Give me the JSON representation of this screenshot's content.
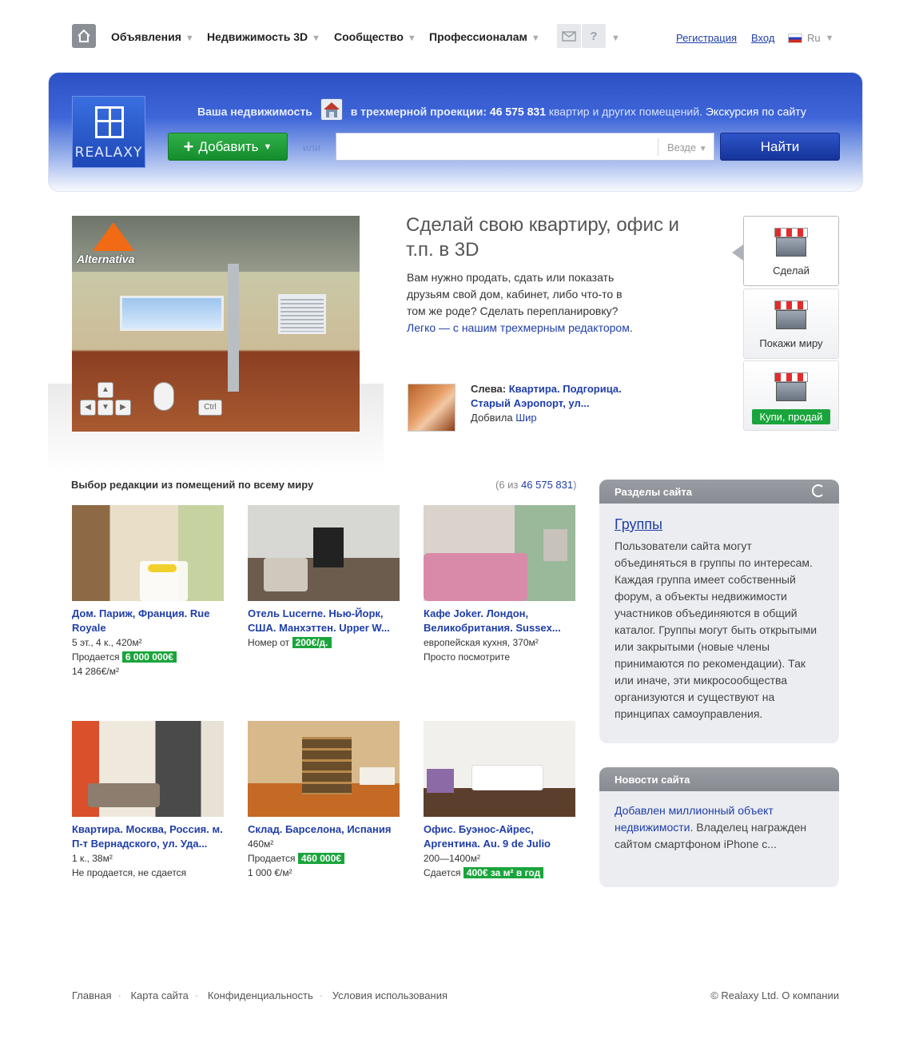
{
  "nav": {
    "items": [
      {
        "label": "Объявления"
      },
      {
        "label": "Недвижимость 3D"
      },
      {
        "label": "Сообщество"
      },
      {
        "label": "Профессионалам"
      }
    ],
    "help_label": "?",
    "register": "Регистрация",
    "login": "Вход",
    "lang": "Ru"
  },
  "banner": {
    "logo_text": "REALAXY",
    "tag_prefix": "Ваша недвижимость",
    "tag_middle": "в трехмерной проекции:",
    "count": "46 575 831",
    "tag_suffix": "квартир и других помещений.",
    "tour_link": "Экскурсия по сайту",
    "add_button": "Добавить",
    "or": "или",
    "search_placeholder": "",
    "where": "Везде",
    "find_button": "Найти"
  },
  "promo": {
    "brand": "Alternativa",
    "title": "Сделай свою квартиру, офис и т.п. в 3D",
    "text": "Вам нужно продать, сдать или показать друзьям свой дом, кабинет, либо что-то в том же роде? Сделать  перепланировку?",
    "link": "Легко — с нашим трехмерным редактором",
    "link_tail": ".",
    "credit_label": "Слева:",
    "credit_title": "Квартира. Подгорица. Старый Аэропорт, ул...",
    "added_by_label": "Добвила",
    "added_by": "Шир",
    "steps": [
      {
        "label": "Сделай"
      },
      {
        "label": "Покажи миру"
      },
      {
        "label": "Купи, продай"
      }
    ]
  },
  "editors": {
    "title": "Выбор редакции из помещений по всему миру",
    "count_prefix": "(6 из",
    "count": "46 575 831",
    "count_suffix": ")",
    "cards": [
      {
        "title": "Дом. Париж, Франция. Rue Royale",
        "line1": "5 эт., 4 к., 420м²",
        "line2_text": "Продается",
        "price": "6 000 000€",
        "line3": "14 286€/м²"
      },
      {
        "title": "Отель Lucerne. Нью-Йорк, США. Манхэттен. Upper W...",
        "line1_text": "Номер от",
        "price": "200€/д."
      },
      {
        "title": "Кафе Joker. Лондон, Великобритания. Sussex...",
        "line1": "европейская кухня, 370м²",
        "line2": "Просто посмотрите"
      },
      {
        "title": "Квартира. Москва, Россия. м. П-т Вернадского, ул. Уда...",
        "line1": "1 к., 38м²",
        "line2": "Не продается, не сдается"
      },
      {
        "title": "Склад. Барселона, Испания",
        "line1": "460м²",
        "line2_text": "Продается",
        "price": "460 000€",
        "line3": "1 000 €/м²"
      },
      {
        "title": "Офис. Буэнос-Айрес, Аргентина. Au. 9 de Julio",
        "line1": "200—1400м²",
        "line2_text": "Сдается",
        "price": "400€ за м² в год"
      }
    ]
  },
  "sections_box": {
    "title": "Разделы сайта",
    "link": "Группы",
    "text": "Пользователи сайта могут объединяться в группы по интересам. Каждая группа имеет собственный форум, а объекты недвижимости участников объединяются в общий каталог. Группы могут быть открытыми или закрытыми (новые члены принимаются по рекомендации). Так или иначе, эти микросообщества организуются и существуют на принципах самоуправления."
  },
  "news_box": {
    "title": "Новости сайта",
    "link": "Добавлен миллионный объект недвижимости",
    "text": ". Владелец награжден сайтом смартфоном iPhone с..."
  },
  "footer": {
    "links": [
      "Главная",
      "Карта сайта",
      "Конфиденциальность",
      "Условия использования"
    ],
    "copyright": "© Realaxy Ltd.",
    "about": "О компании"
  }
}
